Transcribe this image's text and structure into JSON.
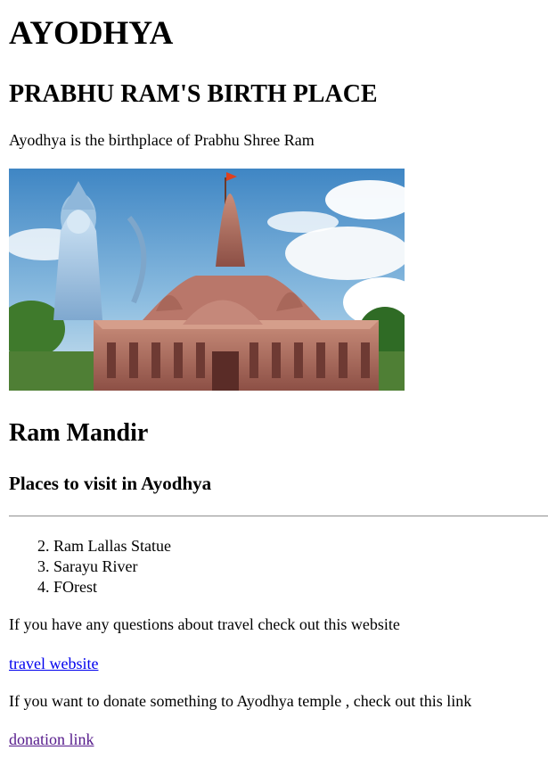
{
  "page": {
    "title": "AYODHYA",
    "subtitle": "PRABHU RAM'S BIRTH PLACE",
    "intro": "Ayodhya is the birthplace of Prabhu Shree Ram",
    "image": "ram-mandir-photo",
    "section_title": "Ram Mandir",
    "places_heading": "Places to visit in Ayodhya",
    "places": [
      {
        "number": "2.",
        "label": "Ram Lallas Statue"
      },
      {
        "number": "3.",
        "label": "Sarayu River"
      },
      {
        "number": "4.",
        "label": "FOrest"
      }
    ],
    "travel_text": "If you have any questions about travel check out this website",
    "travel_link": "travel website",
    "donate_text": "If you want to donate something to Ayodhya temple , check out this link",
    "donate_link": "donation link"
  },
  "colors": {
    "link": "#0000ee",
    "visited_link": "#551a8b"
  }
}
